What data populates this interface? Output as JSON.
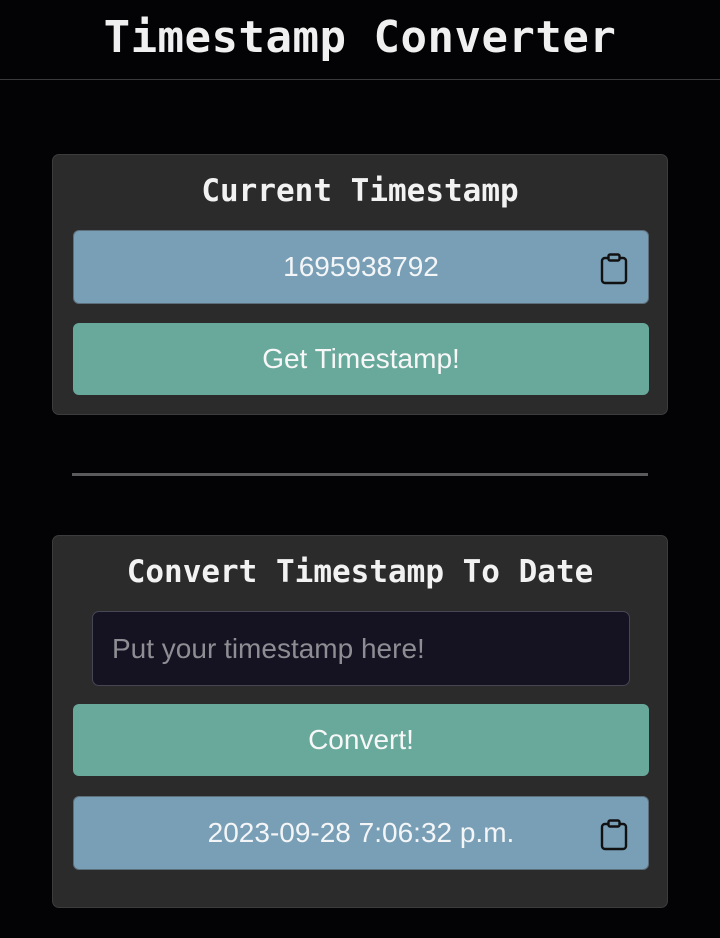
{
  "header": {
    "title": "Timestamp Converter"
  },
  "current_card": {
    "title": "Current Timestamp",
    "timestamp_value": "1695938792",
    "button_label": "Get Timestamp!",
    "copy_icon": "clipboard-icon"
  },
  "convert_card": {
    "title": "Convert Timestamp To Date",
    "input_value": "",
    "input_placeholder": "Put your timestamp here!",
    "button_label": "Convert!",
    "result_value": "2023-09-28 7:06:32 p.m.",
    "copy_icon": "clipboard-icon"
  },
  "colors": {
    "background": "#030305",
    "card": "#2b2b2b",
    "output_box": "#789fb6",
    "button": "#68a99c",
    "input": "#151221"
  }
}
